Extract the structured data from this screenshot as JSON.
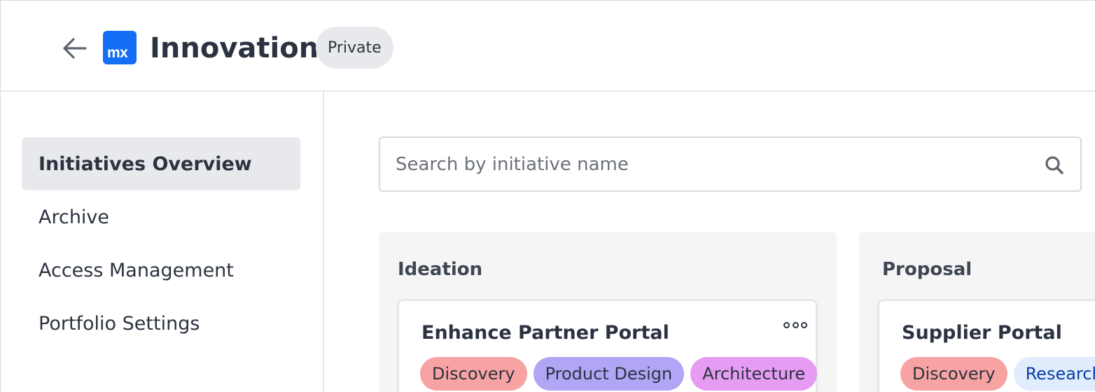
{
  "header": {
    "back_icon": "arrow-left-icon",
    "logo_text": "mx",
    "title": "Innovation",
    "badge": "Private"
  },
  "sidebar": {
    "items": [
      {
        "label": "Initiatives Overview",
        "active": true
      },
      {
        "label": "Archive",
        "active": false
      },
      {
        "label": "Access Management",
        "active": false
      },
      {
        "label": "Portfolio Settings",
        "active": false
      }
    ]
  },
  "search": {
    "placeholder": "Search by initiative name",
    "value": "",
    "icon": "search-icon"
  },
  "columns": [
    {
      "title": "Ideation",
      "cards": [
        {
          "title": "Enhance Partner Portal",
          "tags": [
            {
              "label": "Discovery",
              "color": "#f7a3a3"
            },
            {
              "label": "Product Design",
              "color": "#b0a6f5"
            },
            {
              "label": "Architecture",
              "color": "#e59cf2"
            }
          ]
        }
      ]
    },
    {
      "title": "Proposal",
      "cards": [
        {
          "title": "Supplier Portal",
          "tags": [
            {
              "label": "Discovery",
              "color": "#f7a3a3"
            },
            {
              "label": "Research",
              "color": "#e1edfc",
              "text_color": "#0b3ea6"
            }
          ]
        }
      ]
    }
  ],
  "colors": {
    "brand": "#146ff4",
    "active_bg": "#e8e9ec",
    "text": "#2c3340"
  }
}
